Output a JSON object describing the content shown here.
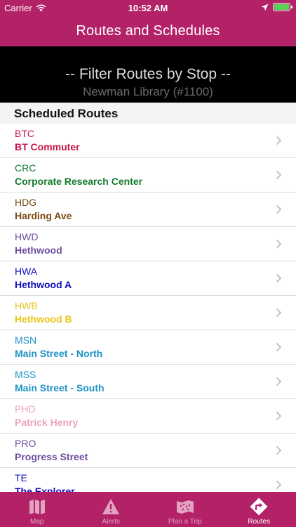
{
  "statusbar": {
    "carrier": "Carrier",
    "time": "10:52 AM"
  },
  "navbar": {
    "title": "Routes and Schedules"
  },
  "filter": {
    "title": "-- Filter Routes by Stop --",
    "selected": "Newman Library (#1100)"
  },
  "section": {
    "title": "Scheduled Routes"
  },
  "routes": [
    {
      "code": "BTC",
      "name": "BT Commuter",
      "color": "#c8144a"
    },
    {
      "code": "CRC",
      "name": "Corporate Research Center",
      "color": "#127a2c"
    },
    {
      "code": "HDG",
      "name": "Harding Ave",
      "color": "#7a4a10"
    },
    {
      "code": "HWD",
      "name": "Hethwood",
      "color": "#6e4ea0"
    },
    {
      "code": "HWA",
      "name": "Hethwood A",
      "color": "#1212b8"
    },
    {
      "code": "HWB",
      "name": "Hethwood B",
      "color": "#e9c619"
    },
    {
      "code": "MSN",
      "name": "Main Street - North",
      "color": "#1d93c4"
    },
    {
      "code": "MSS",
      "name": "Main Street - South",
      "color": "#1d93c4"
    },
    {
      "code": "PHD",
      "name": "Patrick Henry",
      "color": "#eba3c1"
    },
    {
      "code": "PRO",
      "name": "Progress Street",
      "color": "#6e4ea0"
    },
    {
      "code": "TE",
      "name": "The Explorer",
      "color": "#1212b8"
    }
  ],
  "tabs": [
    {
      "label": "Map",
      "icon": "map-icon"
    },
    {
      "label": "Alerts",
      "icon": "alert-icon"
    },
    {
      "label": "Plan a Trip",
      "icon": "plan-trip-icon"
    },
    {
      "label": "Routes",
      "icon": "routes-icon"
    }
  ],
  "colors": {
    "brand": "#b32167",
    "tab_inactive": "#e3a2c1",
    "battery": "#57d158"
  }
}
